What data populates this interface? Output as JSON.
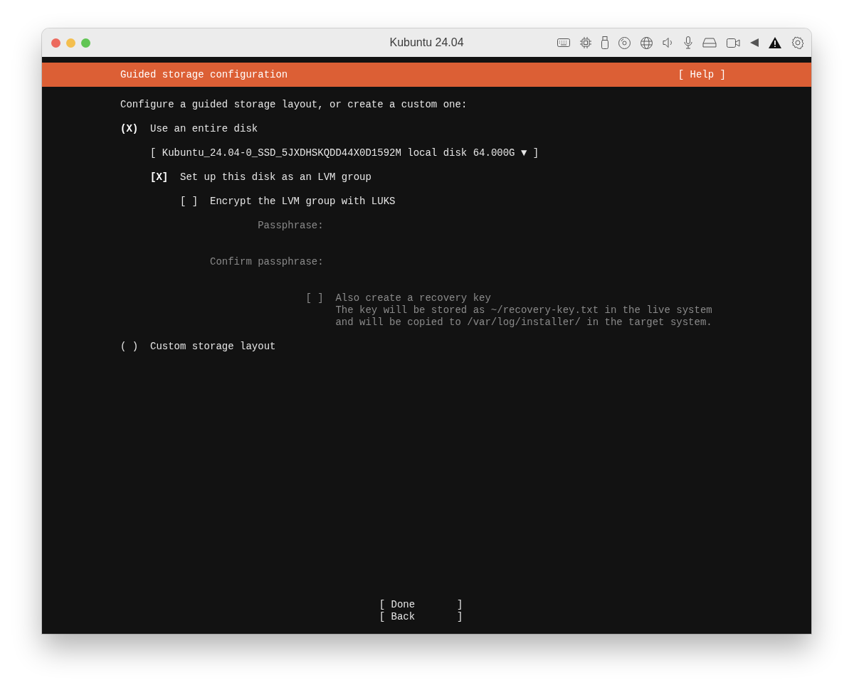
{
  "window": {
    "title": "Kubuntu 24.04"
  },
  "header": {
    "title": "Guided storage configuration",
    "help": "[ Help ]"
  },
  "intro": "Configure a guided storage layout, or create a custom one:",
  "entire_disk": {
    "mark": "(X)",
    "selected": true,
    "label": "Use an entire disk"
  },
  "disk_dropdown": "[ Kubuntu_24.04-0_SSD_5JXDHSKQDD44X0D1592M local disk 64.000G ▼ ]",
  "lvm": {
    "mark": "[X]",
    "checked": true,
    "label": "Set up this disk as an LVM group"
  },
  "luks": {
    "mark": "[ ]",
    "checked": false,
    "label": "Encrypt the LVM group with LUKS"
  },
  "passphrase": {
    "label": "Passphrase:",
    "disabled": true
  },
  "confirm_passphrase": {
    "label": "Confirm passphrase:",
    "disabled": true
  },
  "recovery": {
    "mark": "[ ]",
    "checked": false,
    "disabled": true,
    "label": "Also create a recovery key",
    "note": [
      "The key will be stored as ~/recovery-key.txt in the live system",
      "and will be copied to /var/log/installer/ in the target system."
    ]
  },
  "custom": {
    "mark": "( )",
    "selected": false,
    "label": "Custom storage layout"
  },
  "buttons": [
    "[ Done       ]",
    "[ Back       ]"
  ]
}
